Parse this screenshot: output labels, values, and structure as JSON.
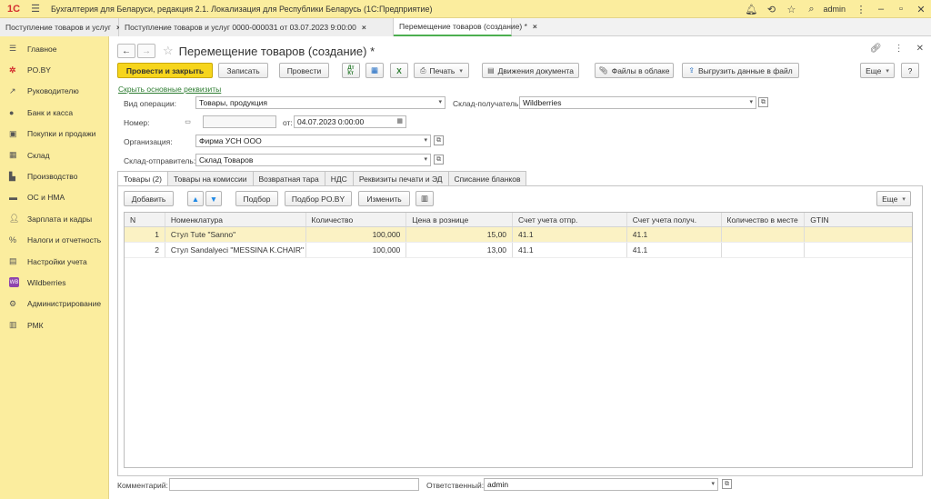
{
  "app": {
    "logo": "1С",
    "title": "Бухгалтерия для Беларуси, редакция 2.1. Локализация для Республики Беларусь  (1С:Предприятие)",
    "user": "admin"
  },
  "window_tabs": [
    {
      "label": "Поступление товаров и услуг"
    },
    {
      "label": "Поступление товаров и услуг 0000-000031 от 03.07.2023 9:00:00"
    },
    {
      "label": "Перемещение товаров (создание) *"
    }
  ],
  "sidebar": {
    "items": [
      {
        "label": "Главное",
        "icon": "menu-icon"
      },
      {
        "label": "PO.BY",
        "icon": "poby-icon"
      },
      {
        "label": "Руководителю",
        "icon": "chart-icon"
      },
      {
        "label": "Банк и касса",
        "icon": "coin-icon"
      },
      {
        "label": "Покупки и продажи",
        "icon": "cart-icon"
      },
      {
        "label": "Склад",
        "icon": "warehouse-icon"
      },
      {
        "label": "Производство",
        "icon": "factory-icon"
      },
      {
        "label": "ОС и НМА",
        "icon": "truck-icon"
      },
      {
        "label": "Зарплата и кадры",
        "icon": "person-icon"
      },
      {
        "label": "Налоги и отчетность",
        "icon": "tax-icon"
      },
      {
        "label": "Настройки учета",
        "icon": "settings-doc-icon"
      },
      {
        "label": "Wildberries",
        "icon": "wildberries-icon"
      },
      {
        "label": "Администрирование",
        "icon": "gear-icon"
      },
      {
        "label": "РМК",
        "icon": "register-icon"
      }
    ]
  },
  "document": {
    "title": "Перемещение товаров (создание) *"
  },
  "toolbar": {
    "post_close": "Провести и закрыть",
    "save": "Записать",
    "post": "Провести",
    "print": "Печать",
    "movements": "Движения документа",
    "cloud_files": "Файлы в облаке",
    "export_file": "Выгрузить данные в файл",
    "more": "Еще",
    "help": "?"
  },
  "toggle_link": "Скрыть основные реквизиты",
  "form": {
    "operation_label": "Вид операции:",
    "operation_value": "Товары, продукция",
    "receiver_label": "Склад-получатель:",
    "receiver_value": "Wildberries",
    "number_label": "Номер:",
    "number_value": "",
    "date_label": "от:",
    "date_value": "04.07.2023  0:00:00",
    "org_label": "Организация:",
    "org_value": "Фирма УСН ООО",
    "sender_label": "Склад-отправитель:",
    "sender_value": "Склад Товаров",
    "comment_label": "Комментарий:",
    "comment_value": "",
    "responsible_label": "Ответственный:",
    "responsible_value": "admin"
  },
  "inner_tabs": [
    {
      "label": "Товары (2)"
    },
    {
      "label": "Товары на комиссии"
    },
    {
      "label": "Возвратная тара"
    },
    {
      "label": "НДС"
    },
    {
      "label": "Реквизиты печати и ЭД"
    },
    {
      "label": "Списание бланков"
    }
  ],
  "table_toolbar": {
    "add": "Добавить",
    "pick": "Подбор",
    "pick_poby": "Подбор PO.BY",
    "change": "Изменить",
    "more": "Еще"
  },
  "table": {
    "headers": [
      "N",
      "Номенклатура",
      "Количество",
      "Цена в рознице",
      "Счет учета отпр.",
      "Счет учета получ.",
      "Количество в месте",
      "GTIN"
    ],
    "rows": [
      {
        "n": "1",
        "nom": "Стул Tute \"Sanno\"",
        "qty": "100,000",
        "price": "15,00",
        "acc_from": "41.1",
        "acc_to": "41.1",
        "qty_place": "",
        "gtin": ""
      },
      {
        "n": "2",
        "nom": "Стул Sandalyeci \"MESSINA K.CHAIR\"",
        "qty": "100,000",
        "price": "13,00",
        "acc_from": "41.1",
        "acc_to": "41.1",
        "qty_place": "",
        "gtin": ""
      }
    ]
  }
}
